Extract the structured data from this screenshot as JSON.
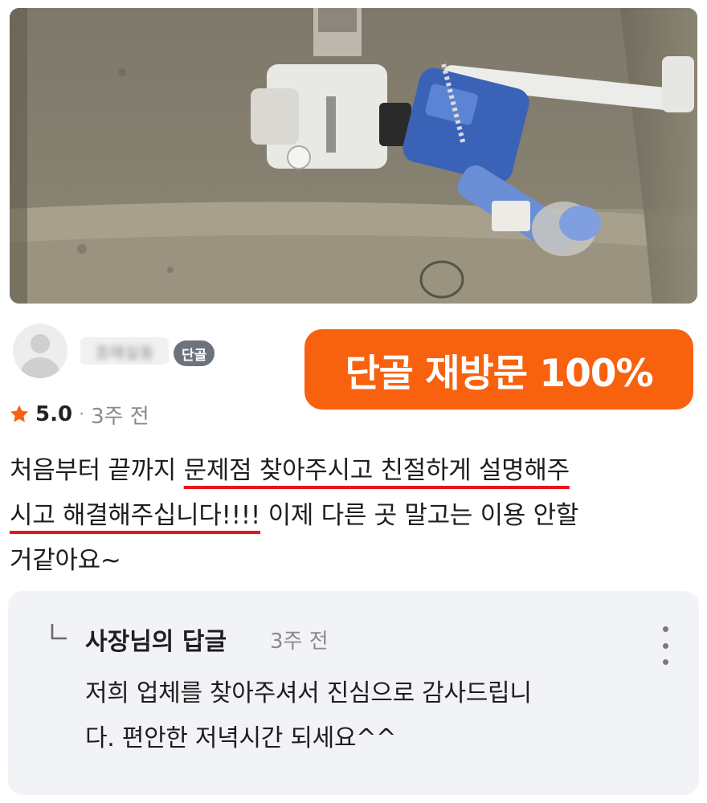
{
  "photo": {
    "icon": "toilet-tank-fill-valve-photo"
  },
  "reviewer": {
    "name": "호매실동",
    "badge": "단골"
  },
  "banner": {
    "text": "단골 재방문 100%",
    "color": "#f8620f"
  },
  "rating": {
    "score": "5.0",
    "separator": "·",
    "time": "3주 전",
    "star_color": "#f8620f"
  },
  "review": {
    "line1_plain": "처음부터 끝까지 ",
    "line1_highlight": "문제점 찾아주시고 친절하게 설명해주",
    "line2_highlight": "시고 해결해주십니다!!!!",
    "line2_plain": " 이제 다른 곳 말고는 이용 안할",
    "line3": "거같아요~",
    "highlight_color": "#e8141c"
  },
  "owner_reply": {
    "title": "사장님의 답글",
    "time": "3주 전",
    "line1": "저희 업체를 찾아주셔서 진심으로 감사드립니",
    "line2": "다. 편안한 저녁시간 되세요^^"
  }
}
